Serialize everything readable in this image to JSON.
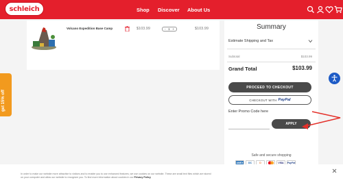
{
  "header": {
    "logo_text": "schleich",
    "nav": [
      "Shop",
      "Discover",
      "About Us"
    ],
    "icons": [
      "search-icon",
      "account-icon",
      "heart-icon",
      "cart-icon"
    ],
    "brand_color": "#e41f2c"
  },
  "cart": {
    "item": {
      "name": "Volcano Expedition Base Camp",
      "unit_price": "$103.99",
      "qty_minus": "-",
      "qty_value": "1",
      "qty_plus": "+",
      "line_price": "$103.99"
    }
  },
  "summary": {
    "title": "Summary",
    "shipping_label": "Estimate Shipping and Tax",
    "subtotal_label": "Subtotal",
    "subtotal_value": "$103.99",
    "grand_total_label": "Grand Total",
    "grand_total_value": "$103.99",
    "checkout_label": "PROCEED TO CHECKOUT",
    "paypal_prefix": "CHECKOUT WITH",
    "paypal_word": "PayPal",
    "promo_label": "Enter Promo Code here",
    "promo_value": "",
    "apply_label": "APPLY",
    "secure_text": "Safe and secure shopping",
    "payment_methods": [
      "AMEX",
      "DC",
      "D",
      "MC",
      "VISA",
      "PayPal"
    ]
  },
  "discount_tab": {
    "label": "get 15% off"
  },
  "cookie": {
    "line1": "In order to make our website more attractive to visitors and to enable you to use enhanced features, we use cookies on our website. These are small text files which are stored",
    "line2": "on your computer and allow our website to recognize you. To find more information about cookies in our",
    "privacy_link": "Privacy Policy"
  },
  "colors": {
    "accent_red": "#e41f2c",
    "button_dark": "#4a4a4a",
    "discount_orange": "#f29a1e",
    "a11y_blue": "#1e5bc6"
  }
}
